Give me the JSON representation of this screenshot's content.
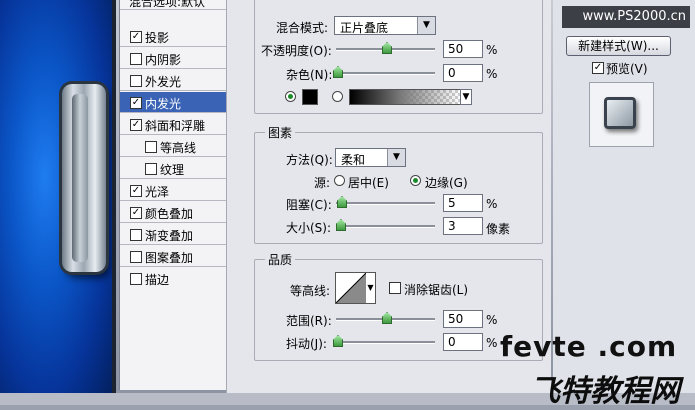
{
  "watermark_top": "www.PS2000.cn",
  "watermark_bottom": {
    "latin": "fevte .com",
    "cjk": "飞特教程网"
  },
  "styles_list": {
    "header": "混合选项:默认",
    "items": [
      {
        "label": "投影",
        "checked": true
      },
      {
        "label": "内阴影",
        "checked": false
      },
      {
        "label": "外发光",
        "checked": false
      },
      {
        "label": "内发光",
        "checked": true,
        "selected": true
      },
      {
        "label": "斜面和浮雕",
        "checked": true
      },
      {
        "label": "等高线",
        "checked": false
      },
      {
        "label": "纹理",
        "checked": false
      },
      {
        "label": "光泽",
        "checked": true
      },
      {
        "label": "颜色叠加",
        "checked": true
      },
      {
        "label": "渐变叠加",
        "checked": false
      },
      {
        "label": "图案叠加",
        "checked": false
      },
      {
        "label": "描边",
        "checked": false
      }
    ]
  },
  "structure": {
    "blend_mode_label": "混合模式:",
    "blend_mode_value": "正片叠底",
    "opacity_label": "不透明度(O):",
    "opacity_value": "50",
    "opacity_unit": "%",
    "noise_label": "杂色(N):",
    "noise_value": "0",
    "noise_unit": "%",
    "color_swatch": "#000000"
  },
  "elements": {
    "title": "图素",
    "technique_label": "方法(Q):",
    "technique_value": "柔和",
    "source_label": "源:",
    "source_center": "居中(E)",
    "source_edge": "边缘(G)",
    "choke_label": "阻塞(C):",
    "choke_value": "5",
    "choke_unit": "%",
    "size_label": "大小(S):",
    "size_value": "3",
    "size_unit": "像素"
  },
  "quality": {
    "title": "品质",
    "contour_label": "等高线:",
    "antialias_label": "消除锯齿(L)",
    "range_label": "范围(R):",
    "range_value": "50",
    "range_unit": "%",
    "jitter_label": "抖动(J):",
    "jitter_value": "0",
    "jitter_unit": "%"
  },
  "right_panel": {
    "new_style_button": "新建样式(W)...",
    "preview_label": "预览(V)",
    "preview_checked": true
  }
}
